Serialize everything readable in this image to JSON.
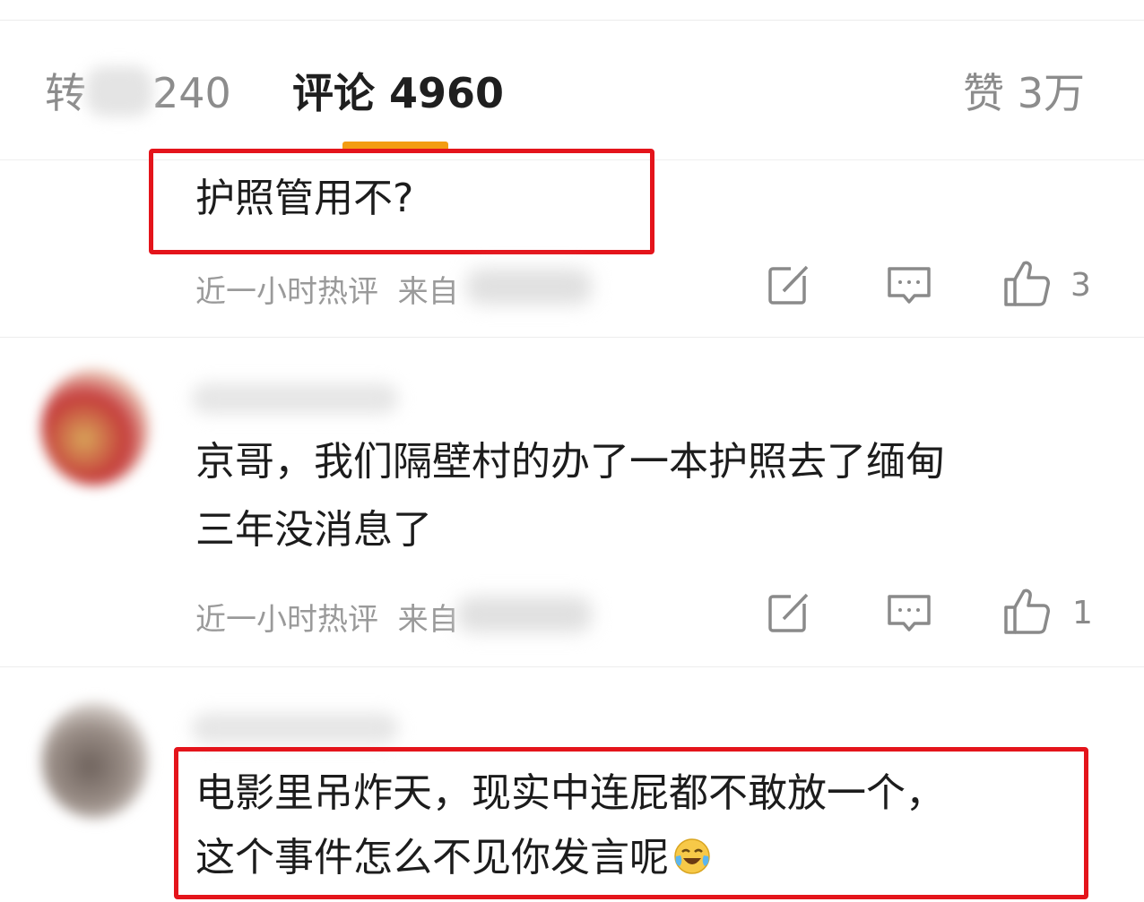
{
  "tabs": {
    "repost_label": "转",
    "repost_count": "240",
    "comments_label": "评论 4960",
    "likes_label": "赞 3万"
  },
  "comments": [
    {
      "lines": [
        "护照管用不?"
      ],
      "time": "近一小时热评",
      "source_prefix": "来自",
      "likes": "3"
    },
    {
      "lines": [
        "京哥，我们隔壁村的办了一本护照去了缅甸",
        "三年没消息了"
      ],
      "time": "近一小时热评",
      "source_prefix": "来自",
      "likes": "1"
    },
    {
      "lines": [
        "电影里吊炸天，现实中连屁都不敢放一个，",
        "这个事件怎么不见你发言呢"
      ],
      "emoji_icon": "laugh-cry-emoji"
    }
  ],
  "colors": {
    "accent": "#f39c12",
    "highlight": "#e4141b",
    "muted": "#9a9a9a"
  }
}
